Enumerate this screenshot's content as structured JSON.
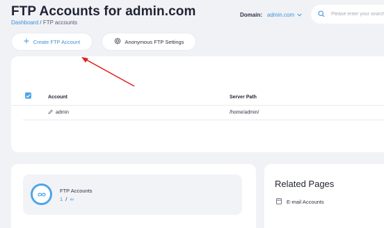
{
  "header": {
    "title": "FTP Accounts for admin.com",
    "breadcrumb": {
      "link": "Dashboard",
      "separator": "/",
      "current": "FTP accounts"
    },
    "domain_label": "Domain:",
    "domain_value": "admin.com",
    "search_placeholder": "Please enter your search"
  },
  "toolbar": {
    "create_label": "Create FTP Account",
    "anonymous_label": "Anonymous FTP Settings"
  },
  "table": {
    "columns": [
      "Account",
      "Server Path"
    ],
    "rows": [
      {
        "account": "admin",
        "server_path": "/home/admin/"
      }
    ]
  },
  "stats": {
    "label": "FTP Accounts",
    "used": "1",
    "separator": "/",
    "limit": "∞"
  },
  "related": {
    "title": "Related Pages",
    "items": [
      "E-mail Accounts"
    ]
  },
  "annotation": {
    "arrow_color": "#e0201b"
  },
  "colors": {
    "accent": "#3f8fd8",
    "checkbox": "#4ea5e6",
    "background": "#f0f2f6"
  }
}
